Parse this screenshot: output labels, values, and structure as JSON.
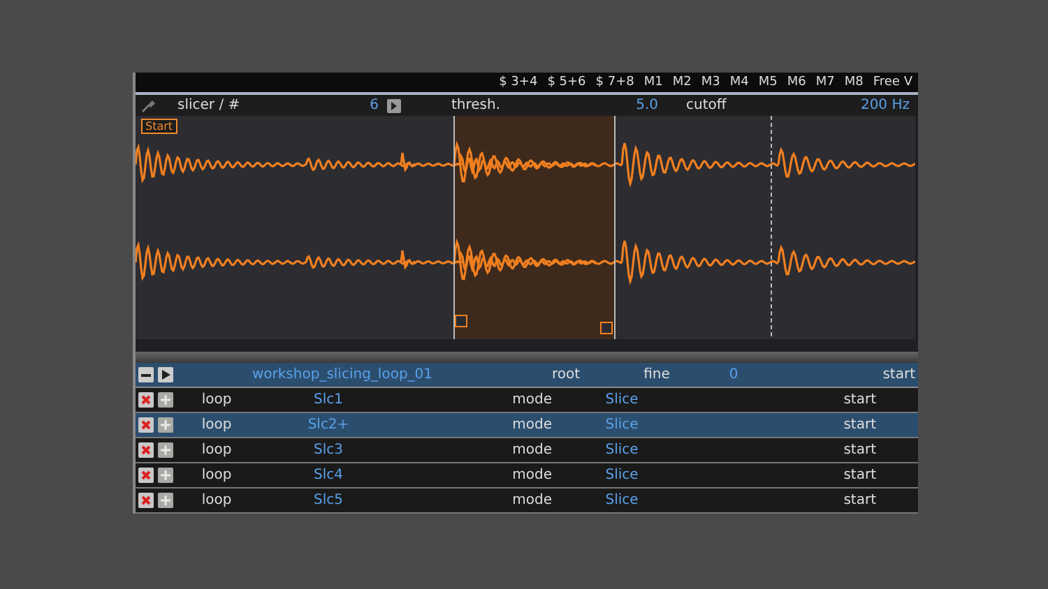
{
  "bus_strip": {
    "labels": [
      "$ 3+4",
      "$ 5+6",
      "$ 7+8",
      "M1",
      "M2",
      "M3",
      "M4",
      "M5",
      "M6",
      "M7",
      "M8",
      "Free V"
    ]
  },
  "controls": {
    "slicer_label": "slicer / #",
    "slicer_value": "6",
    "thresh_label": "thresh.",
    "thresh_value": "5.0",
    "cutoff_label": "cutoff",
    "cutoff_value": "200 Hz"
  },
  "waveform": {
    "start_label": "Start",
    "slices": [
      {
        "selected": false
      },
      {
        "selected": true
      },
      {
        "selected": false
      },
      {
        "selected": false
      }
    ]
  },
  "table": {
    "header": {
      "name": "workshop_slicing_loop_01",
      "root": "root",
      "fine": "fine",
      "fine_value": "0",
      "start": "start"
    },
    "rows": [
      {
        "type": "loop",
        "name": "Slc1",
        "mode": "mode",
        "mode_value": "Slice",
        "start": "start",
        "selected": false
      },
      {
        "type": "loop",
        "name": "Slc2+",
        "mode": "mode",
        "mode_value": "Slice",
        "start": "start",
        "selected": true
      },
      {
        "type": "loop",
        "name": "Slc3",
        "mode": "mode",
        "mode_value": "Slice",
        "start": "start",
        "selected": false
      },
      {
        "type": "loop",
        "name": "Slc4",
        "mode": "mode",
        "mode_value": "Slice",
        "start": "start",
        "selected": false
      },
      {
        "type": "loop",
        "name": "Slc5",
        "mode": "mode",
        "mode_value": "Slice",
        "start": "start",
        "selected": false
      }
    ]
  }
}
